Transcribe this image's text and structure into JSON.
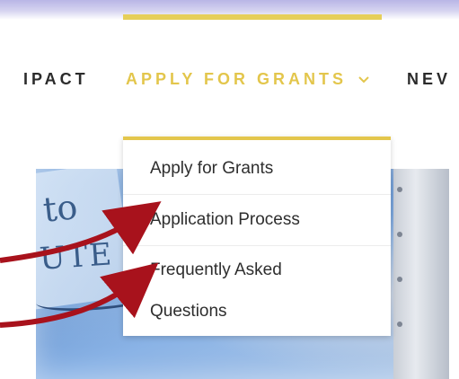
{
  "nav": {
    "items": [
      {
        "label": "IPACT"
      },
      {
        "label": "APPLY FOR GRANTS",
        "active": true
      },
      {
        "label": "NEV"
      }
    ],
    "active_color": "#e3c64c",
    "chevron_icon": "chevron-down-icon"
  },
  "dropdown": {
    "items": [
      {
        "label": "Apply for Grants"
      },
      {
        "label": "Application Process"
      },
      {
        "label_line1": "Frequently Asked",
        "label_line2": "Questions"
      }
    ],
    "accent_color": "#e3c64c"
  },
  "annotations": {
    "arrow_color": "#a8121c",
    "arrow_icon": "red-arrow-annotation"
  }
}
